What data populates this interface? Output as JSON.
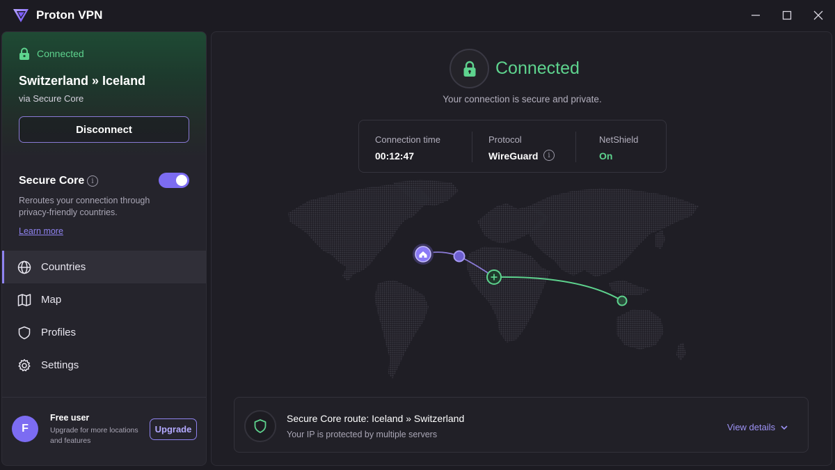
{
  "app": {
    "title": "Proton VPN",
    "accent": "#7c6cf2",
    "connected_color": "#5ed38e"
  },
  "sidebar": {
    "connection": {
      "status": "Connected",
      "route": "Switzerland » Iceland",
      "via": "via Secure Core",
      "disconnect_label": "Disconnect"
    },
    "secure_core": {
      "title": "Secure Core",
      "enabled": true,
      "description": "Reroutes your connection through privacy-friendly countries.",
      "learn_more": "Learn more"
    },
    "nav": [
      {
        "label": "Countries",
        "icon": "globe-icon",
        "active": true
      },
      {
        "label": "Map",
        "icon": "map-icon",
        "active": false
      },
      {
        "label": "Profiles",
        "icon": "shield-icon",
        "active": false
      },
      {
        "label": "Settings",
        "icon": "gear-icon",
        "active": false
      }
    ],
    "user": {
      "avatar_letter": "F",
      "name": "Free user",
      "description": "Upgrade for more locations and features",
      "upgrade_label": "Upgrade"
    }
  },
  "main": {
    "status": "Connected",
    "subtitle": "Your connection is secure and private.",
    "stats": [
      {
        "label": "Connection time",
        "value": "00:12:47"
      },
      {
        "label": "Protocol",
        "value": "WireGuard"
      },
      {
        "label": "NetShield",
        "value": "On"
      }
    ],
    "route_card": {
      "title": "Secure Core route: Iceland  »  Switzerland",
      "subtitle": "Your IP is protected by multiple servers",
      "view_details": "View details"
    }
  }
}
